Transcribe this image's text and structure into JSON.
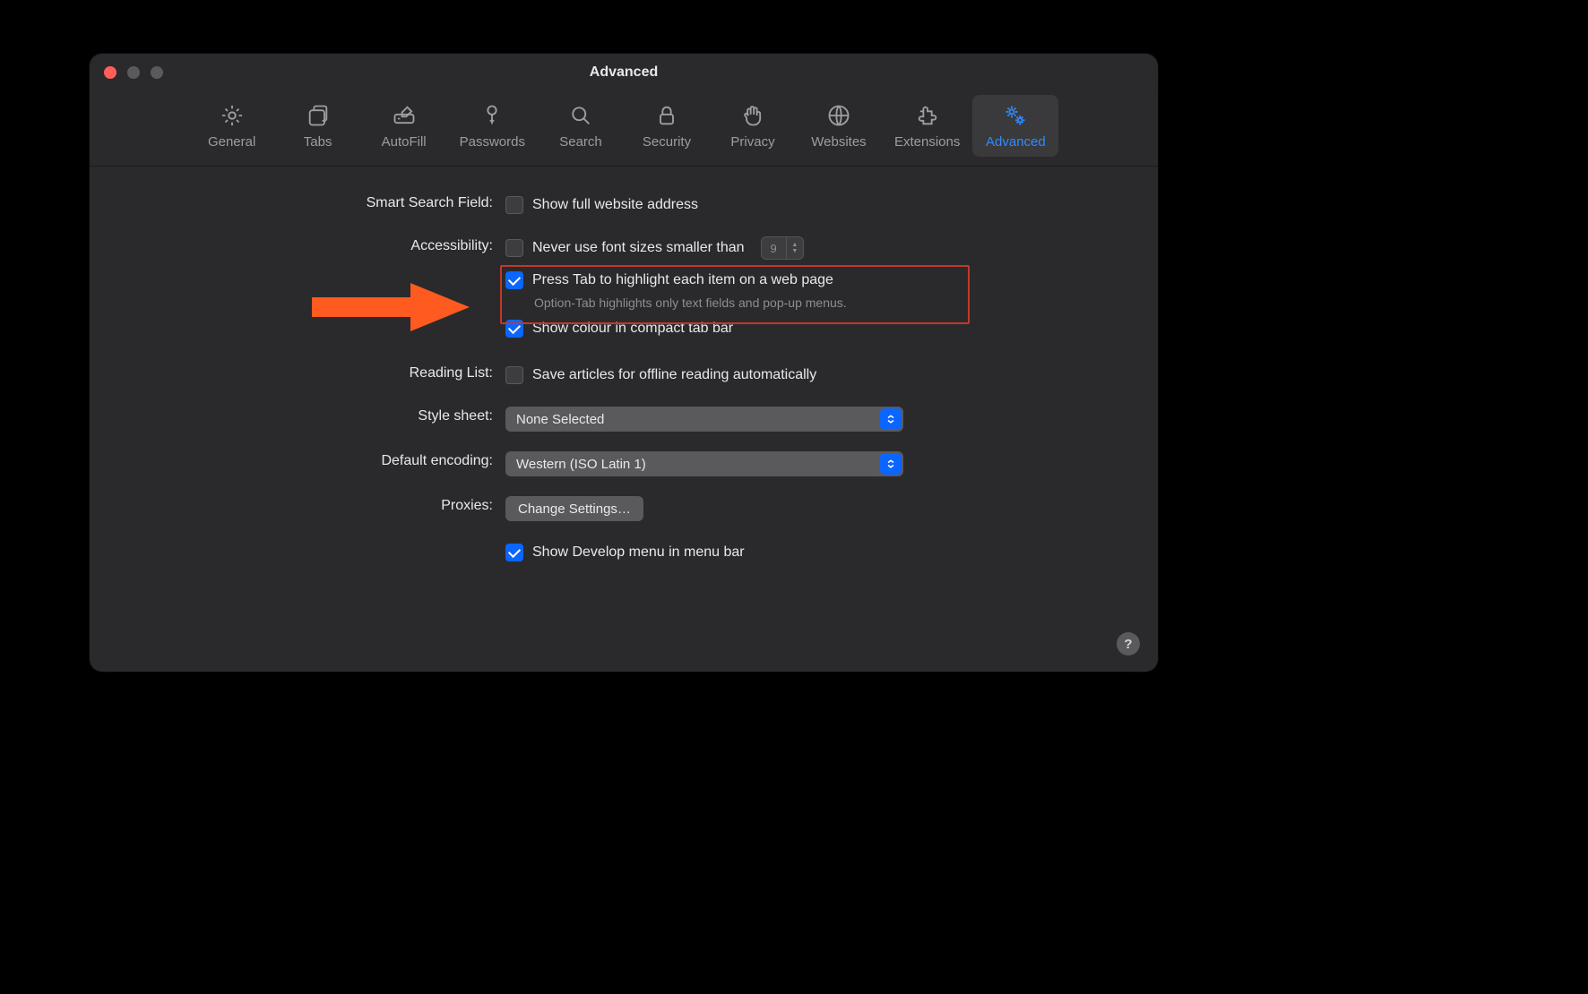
{
  "window": {
    "title": "Advanced"
  },
  "toolbar": {
    "items": [
      {
        "id": "general",
        "label": "General"
      },
      {
        "id": "tabs",
        "label": "Tabs"
      },
      {
        "id": "autofill",
        "label": "AutoFill"
      },
      {
        "id": "passwords",
        "label": "Passwords"
      },
      {
        "id": "search",
        "label": "Search"
      },
      {
        "id": "security",
        "label": "Security"
      },
      {
        "id": "privacy",
        "label": "Privacy"
      },
      {
        "id": "websites",
        "label": "Websites"
      },
      {
        "id": "extensions",
        "label": "Extensions"
      },
      {
        "id": "advanced",
        "label": "Advanced"
      }
    ],
    "active": "advanced"
  },
  "sections": {
    "smart_search": {
      "label": "Smart Search Field:",
      "show_full_url": {
        "label": "Show full website address",
        "checked": false
      }
    },
    "accessibility": {
      "label": "Accessibility:",
      "min_font": {
        "label": "Never use font sizes smaller than",
        "checked": false,
        "value": "9"
      },
      "press_tab": {
        "label": "Press Tab to highlight each item on a web page",
        "note": "Option-Tab highlights only text fields and pop-up menus.",
        "checked": true
      },
      "show_colour": {
        "label": "Show colour in compact tab bar",
        "checked": true
      }
    },
    "reading_list": {
      "label": "Reading List:",
      "save_offline": {
        "label": "Save articles for offline reading automatically",
        "checked": false
      }
    },
    "style_sheet": {
      "label": "Style sheet:",
      "value": "None Selected"
    },
    "default_encoding": {
      "label": "Default encoding:",
      "value": "Western (ISO Latin 1)"
    },
    "proxies": {
      "label": "Proxies:",
      "button": "Change Settings…"
    },
    "develop_menu": {
      "label": "Show Develop menu in menu bar",
      "checked": true
    }
  },
  "help": "?",
  "annotation": {
    "highlight_color": "#c0392b",
    "arrow_color": "#ff5a1f"
  }
}
